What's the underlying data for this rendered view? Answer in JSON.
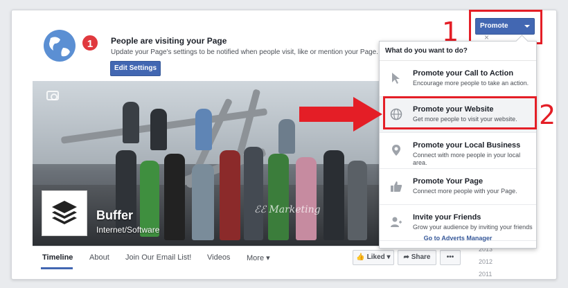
{
  "notification": {
    "badge_count": "1",
    "title": "People are visiting your Page",
    "text": "Update your Page's settings to be notified when people visit, like or mention your Page.",
    "button": "Edit Settings",
    "close": "×"
  },
  "page": {
    "name": "Buffer",
    "category": "Internet/Software",
    "watermark": "ℰℰ Marketing"
  },
  "nav": {
    "tabs": [
      "Timeline",
      "About",
      "Join Our Email List!",
      "Videos",
      "More ▾"
    ],
    "liked": "Liked ▾",
    "share": "Share",
    "more": "•••"
  },
  "years": [
    "2013",
    "2012",
    "2011"
  ],
  "promote": {
    "button": "Promote",
    "header": "What do you want to do?",
    "items": [
      {
        "title": "Promote your Call to Action",
        "sub": "Encourage more people to take an action.",
        "icon": "cursor-icon"
      },
      {
        "title": "Promote your Website",
        "sub": "Get more people to visit your website.",
        "icon": "globe-icon"
      },
      {
        "title": "Promote your Local Business",
        "sub": "Connect with more people in your local area.",
        "icon": "location-pin-icon"
      },
      {
        "title": "Promote Your Page",
        "sub": "Connect more people with your Page.",
        "icon": "thumbs-up-icon"
      },
      {
        "title": "Invite your Friends",
        "sub": "Grow your audience by inviting your friends",
        "icon": "add-person-icon"
      }
    ],
    "footer": "Go to Adverts Manager"
  },
  "annotations": {
    "one": "1",
    "two": "2"
  },
  "colors": {
    "brand": "#4267b2",
    "annotation": "#e41e26"
  }
}
